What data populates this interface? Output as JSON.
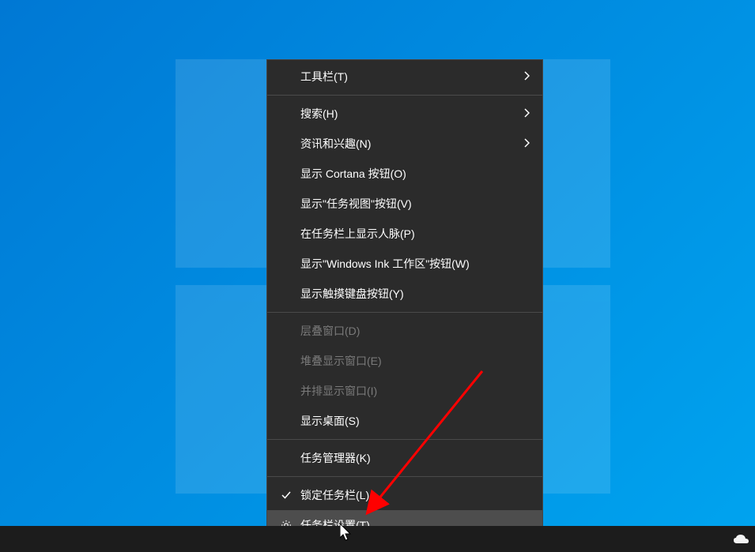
{
  "menu": {
    "items": [
      {
        "label": "工具栏(T)",
        "hasArrow": true
      },
      {
        "label": "搜索(H)",
        "hasArrow": true
      },
      {
        "label": "资讯和兴趣(N)",
        "hasArrow": true
      },
      {
        "label": "显示 Cortana 按钮(O)"
      },
      {
        "label": "显示\"任务视图\"按钮(V)"
      },
      {
        "label": "在任务栏上显示人脉(P)"
      },
      {
        "label": "显示\"Windows Ink 工作区\"按钮(W)"
      },
      {
        "label": "显示触摸键盘按钮(Y)"
      },
      {
        "label": "层叠窗口(D)",
        "disabled": true
      },
      {
        "label": "堆叠显示窗口(E)",
        "disabled": true
      },
      {
        "label": "并排显示窗口(I)",
        "disabled": true
      },
      {
        "label": "显示桌面(S)"
      },
      {
        "label": "任务管理器(K)"
      },
      {
        "label": "锁定任务栏(L)",
        "checked": true
      },
      {
        "label": "任务栏设置(T)",
        "gear": true,
        "highlighted": true
      }
    ]
  }
}
